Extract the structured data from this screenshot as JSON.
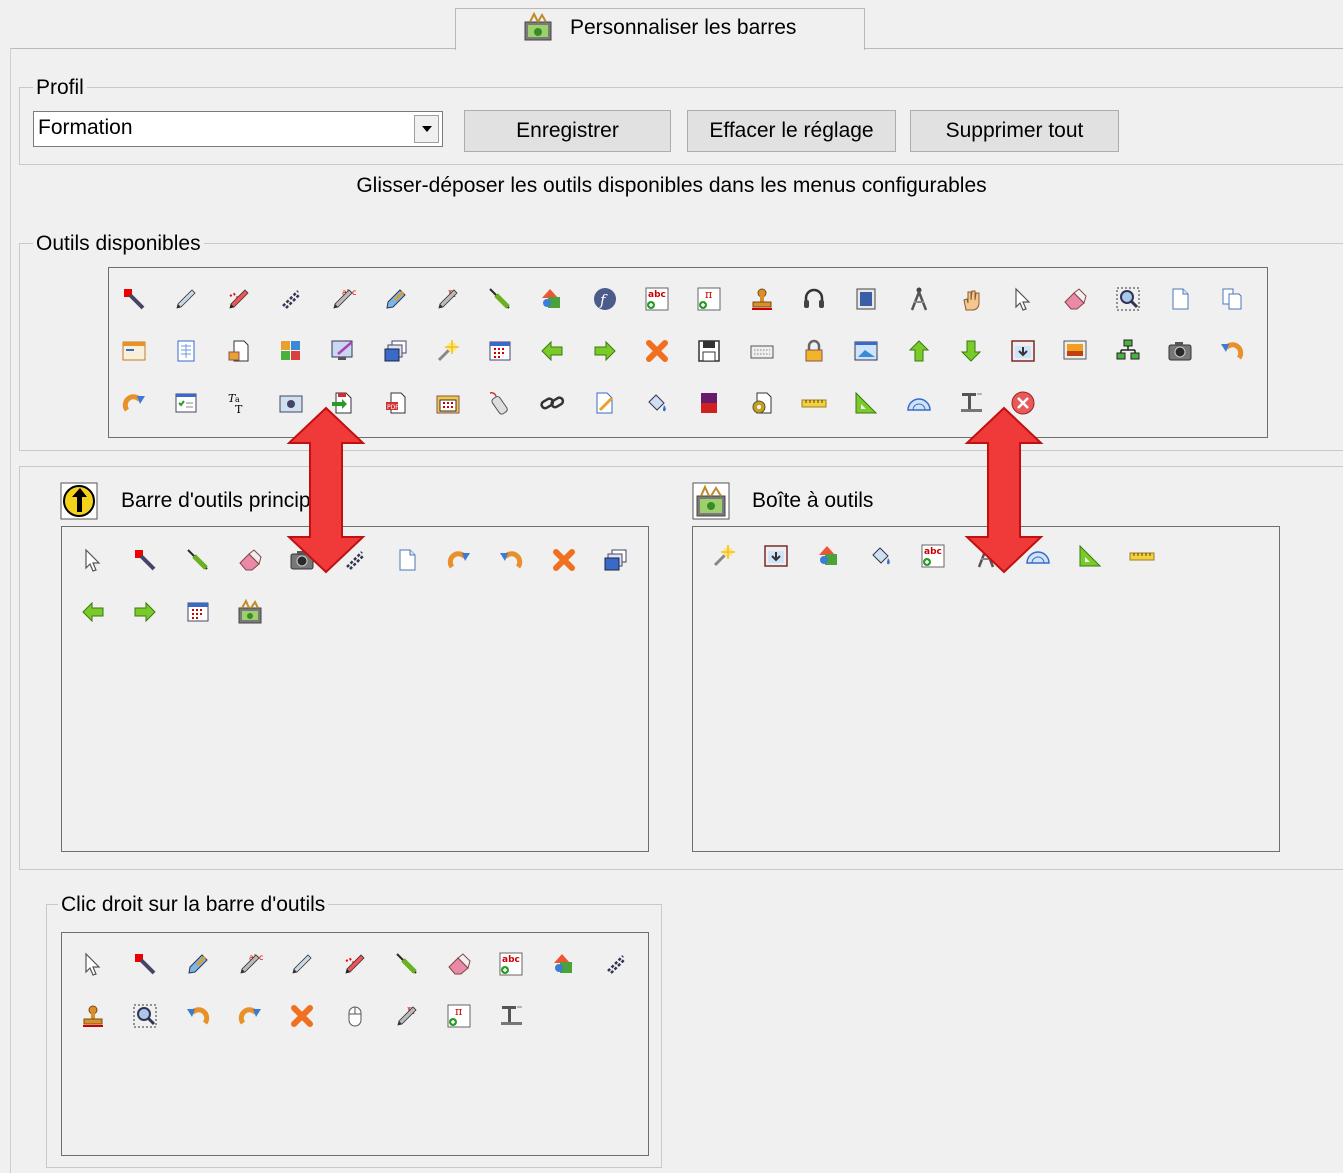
{
  "tab": {
    "label": "Personnaliser les barres",
    "icon": "toolbox-icon"
  },
  "profile": {
    "legend": "Profil",
    "selected": "Formation",
    "buttons": {
      "save": "Enregistrer",
      "reset": "Effacer le réglage",
      "delete_all": "Supprimer tout"
    }
  },
  "instruction": "Glisser-déposer les outils disponibles dans les menus configurables",
  "available": {
    "legend": "Outils disponibles",
    "rows": [
      [
        "pen-red-icon",
        "pencil-icon",
        "dotted-pen-icon",
        "line-pen-icon",
        "abc-pen-icon",
        "highlighter-icon",
        "pi-pen-icon",
        "green-pen-icon",
        "shapes-icon",
        "flash-icon",
        "text-table-icon",
        "pi-table-icon",
        "stamp-icon",
        "headphones-icon",
        "video-frame-icon",
        "compass-icon",
        "hand-icon",
        "cursor-icon",
        "eraser-icon",
        "zoom-select-icon",
        "page-icon",
        "copy-page-icon"
      ],
      [
        "window-icon",
        "document-grid-icon",
        "page-export-icon",
        "page-color-icon",
        "edit-screen-icon",
        "layers-icon",
        "magic-wand-icon",
        "calendar-grid-icon",
        "arrow-left-icon",
        "arrow-right-icon",
        "delete-x-icon",
        "save-icon",
        "keyboard-icon",
        "lock-icon",
        "window-image-icon",
        "arrow-up-icon",
        "arrow-down-icon",
        "screen-down-icon",
        "image-frame-icon",
        "network-icon",
        "camera-icon",
        "undo-icon"
      ],
      [
        "redo-icon",
        "checklist-icon",
        "text-format-icon",
        "camera-window-icon",
        "import-icon",
        "pdf-export-icon",
        "folder-grid-icon",
        "remote-icon",
        "link-icon",
        "page-edit-icon",
        "fill-bucket-icon",
        "gradient-icon",
        "gear-page-icon",
        "ruler-icon",
        "set-square-icon",
        "protractor-icon",
        "beam-icon",
        "close-circle-icon"
      ]
    ]
  },
  "main_toolbar": {
    "label": "Barre d'outils principale",
    "icon": "main-toolbar-icon",
    "rows": [
      [
        "cursor-icon",
        "pen-red-icon",
        "green-pen-icon",
        "eraser-icon",
        "camera-icon",
        "line-pen-icon",
        "page-icon",
        "redo-icon",
        "undo-icon",
        "delete-x-icon",
        "layers-icon"
      ],
      [
        "arrow-left-icon",
        "arrow-right-icon",
        "calendar-grid-icon",
        "toolbox-icon"
      ]
    ]
  },
  "toolbox": {
    "label": "Boîte à outils",
    "icon": "toolbox-icon",
    "rows": [
      [
        "magic-wand-icon",
        "screen-down-icon",
        "shapes-icon",
        "fill-bucket-icon",
        "text-table-icon",
        "compass-icon",
        "protractor-icon",
        "set-square-icon",
        "ruler-icon"
      ]
    ]
  },
  "right_click": {
    "legend": "Clic droit sur la barre d'outils",
    "rows": [
      [
        "cursor-icon",
        "pen-red-icon",
        "highlighter-icon",
        "abc-pen-icon",
        "pencil-icon",
        "dotted-pen-icon",
        "green-pen-icon",
        "eraser-icon",
        "text-table-icon",
        "shapes-icon",
        "line-pen-icon"
      ],
      [
        "stamp-icon",
        "zoom-select-icon",
        "undo-icon",
        "redo-icon",
        "delete-x-icon",
        "mouse-icon",
        "pi-pen-icon",
        "pi-table-icon",
        "beam-icon"
      ]
    ]
  },
  "colors": {
    "accent_red": "#f03a3a",
    "arrow_border": "#c01010"
  }
}
